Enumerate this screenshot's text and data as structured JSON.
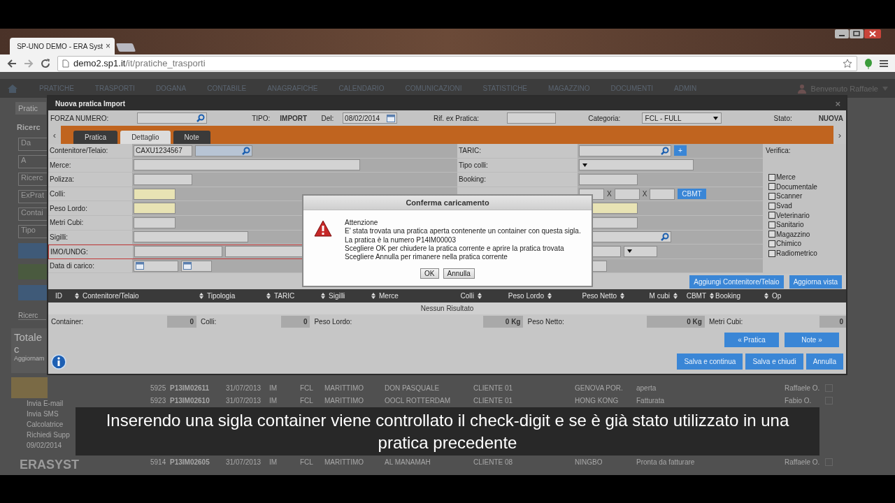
{
  "browser": {
    "tab_title": "SP-UNO DEMO - ERA Syst",
    "tab_close": "×",
    "url_host": "demo2.sp1.it",
    "url_path": "/it/pratiche_trasporti"
  },
  "menu": {
    "items": [
      "PRATICHE",
      "TRASPORTI",
      "DOGANA",
      "CONTABILE",
      "ANAGRAFICHE",
      "CALENDARIO",
      "COMUNICAZIONI",
      "STATISTICHE",
      "MAGAZZINO",
      "DOCUMENTI",
      "ADMIN"
    ],
    "user": "Benvenuto Raffaele"
  },
  "sidebar": {
    "tab": "Pratic",
    "section": "Ricerc",
    "fields": [
      "Da",
      "A",
      "Ricerc",
      "ExPrat",
      "Contai",
      "Tipo"
    ],
    "note": "Ricerc",
    "total": "Totale c",
    "total_sub": "Aggiornam",
    "links": [
      "Invia E-mail",
      "Invia SMS",
      "Calcolatrice",
      "Richiedi Supp",
      "09/02/2014"
    ],
    "logo": "ERASYST"
  },
  "background_rows": [
    {
      "cells": [
        "5925",
        "P13IM02611",
        "31/07/2013",
        "IM",
        "FCL",
        "MARITTIMO",
        "DON PASQUALE",
        "CLIENTE 01",
        "GENOVA POR.",
        "aperta",
        "Raffaele O."
      ],
      "checked": false
    },
    {
      "cells": [
        "5923",
        "P13IM02610",
        "31/07/2013",
        "IM",
        "FCL",
        "MARITTIMO",
        "OOCL ROTTERDAM",
        "CLIENTE 01",
        "HONG KONG",
        "Fatturata",
        "Fabio O."
      ],
      "checked": false
    },
    {
      "cells": [
        "5914",
        "P13IM02605",
        "31/07/2013",
        "IM",
        "FCL",
        "MARITTIMO",
        "AL MANAMAH",
        "CLIENTE 08",
        "NINGBO",
        "Pronta da fatturare",
        "Raffaele O."
      ],
      "checked": false
    }
  ],
  "modal": {
    "title": "Nuova pratica Import",
    "close": "×",
    "header": {
      "forza_label": "FORZA NUMERO:",
      "tipo_label": "TIPO:",
      "tipo": "IMPORT",
      "del_label": "Del:",
      "del": "08/02/2014",
      "rif_label": "Rif. ex Pratica:",
      "categoria_label": "Categoria:",
      "categoria": "FCL - FULL",
      "stato_label": "Stato:",
      "stato": "NUOVA"
    },
    "tabs": [
      {
        "label": "Pratica",
        "selected": false
      },
      {
        "label": "Dettaglio",
        "selected": true
      },
      {
        "label": "Note",
        "selected": false
      }
    ],
    "tab_prev": "‹",
    "tab_next": "›",
    "left_rows": [
      {
        "label": "Contenitore/Telaio:",
        "kind": "container",
        "value": "CAXU1234567",
        "highlighted": false,
        "error": false
      },
      {
        "label": "Merce:",
        "kind": "wide",
        "highlighted": false,
        "error": false
      },
      {
        "label": "Polizza:",
        "kind": "short",
        "highlighted": false,
        "error": false
      },
      {
        "label": "Colli:",
        "kind": "tiny",
        "highlighted": true,
        "error": false
      },
      {
        "label": "Peso Lordo:",
        "kind": "tiny",
        "highlighted": true,
        "error": false
      },
      {
        "label": "Metri Cubi:",
        "kind": "tiny",
        "highlighted": false,
        "error": false
      },
      {
        "label": "Sigilli:",
        "kind": "medium",
        "highlighted": false,
        "error": false
      },
      {
        "label": "IMO/UNDG:",
        "kind": "double",
        "highlighted": false,
        "error": true
      },
      {
        "label": "Data di carico:",
        "kind": "dates",
        "highlighted": false,
        "error": false
      }
    ],
    "mid_rows": [
      {
        "label": "TARIC:",
        "kind": "search_add",
        "button": "+",
        "highlighted": false
      },
      {
        "label": "Tipo colli:",
        "kind": "select",
        "highlighted": false
      },
      {
        "label": "Booking:",
        "kind": "text",
        "highlighted": false
      },
      {
        "kind": "dims",
        "separators": [
          "X",
          "X"
        ],
        "button": "CBMT",
        "highlighted": false
      },
      {
        "kind": "text",
        "highlighted": true
      },
      {
        "kind": "text",
        "highlighted": false
      },
      {
        "kind": "search",
        "highlighted": false
      },
      {
        "kind": "text_select",
        "highlighted": false
      },
      {
        "kind": "select_small",
        "highlighted": false
      }
    ],
    "verify_label": "Verifica:",
    "checks": [
      {
        "label": "Merce",
        "checked": false
      },
      {
        "label": "Documentale",
        "checked": false
      },
      {
        "label": "Scanner",
        "checked": false
      },
      {
        "label": "Svad",
        "checked": false
      },
      {
        "label": "Veterinario",
        "checked": false
      },
      {
        "label": "Sanitario",
        "checked": false
      },
      {
        "label": "Magazzino",
        "checked": false
      },
      {
        "label": "Chimico",
        "checked": false
      },
      {
        "label": "Radiometrico",
        "checked": false
      }
    ],
    "actions": [
      "Aggiungi Contenitore/Telaio",
      "Aggiorna vista"
    ],
    "columns": [
      {
        "label": "ID",
        "sortable": false
      },
      {
        "label": "Contenitore/Telaio",
        "sortable": true
      },
      {
        "label": "Tipologia",
        "sortable": true
      },
      {
        "label": "TARIC",
        "sortable": true
      },
      {
        "label": "Sigilli",
        "sortable": true
      },
      {
        "label": "Merce",
        "sortable": true
      },
      {
        "label": "Colli",
        "sortable": true
      },
      {
        "label": "Peso Lordo",
        "sortable": true
      },
      {
        "label": "Peso Netto",
        "sortable": true
      },
      {
        "label": "M cubi",
        "sortable": true
      },
      {
        "label": "CBMT",
        "sortable": true
      },
      {
        "label": "Booking",
        "sortable": false
      },
      {
        "label": "Op",
        "sortable": true
      }
    ],
    "empty": "Nessun Risultato",
    "totals": [
      {
        "label": "Container:",
        "value": "0"
      },
      {
        "label": "Colli:",
        "value": "0"
      },
      {
        "label": "Peso Lordo:",
        "value": "0 Kg"
      },
      {
        "label": "Peso Netto:",
        "value": "0 Kg"
      },
      {
        "label": "Metri Cubi:",
        "value": "0"
      }
    ],
    "nav": [
      "« Pratica",
      "Note »"
    ],
    "footer_buttons": [
      "Salva e continua",
      "Salva e chiudi",
      "Annulla"
    ]
  },
  "dialog": {
    "title": "Conferma caricamento",
    "lines": [
      "Attenzione",
      "E' stata trovata una pratica aperta contenente un container con questa sigla.",
      "La pratica è la numero P14IM00003",
      "Scegliere OK per chiudere la pratica corrente e aprire la pratica trovata",
      "Scegliere Annulla per rimanere nella pratica corrente"
    ],
    "buttons": [
      "OK",
      "Annulla"
    ]
  },
  "subtitle": "Inserendo una sigla container viene controllato il check-digit e se è già stato utilizzato in una pratica precedente"
}
